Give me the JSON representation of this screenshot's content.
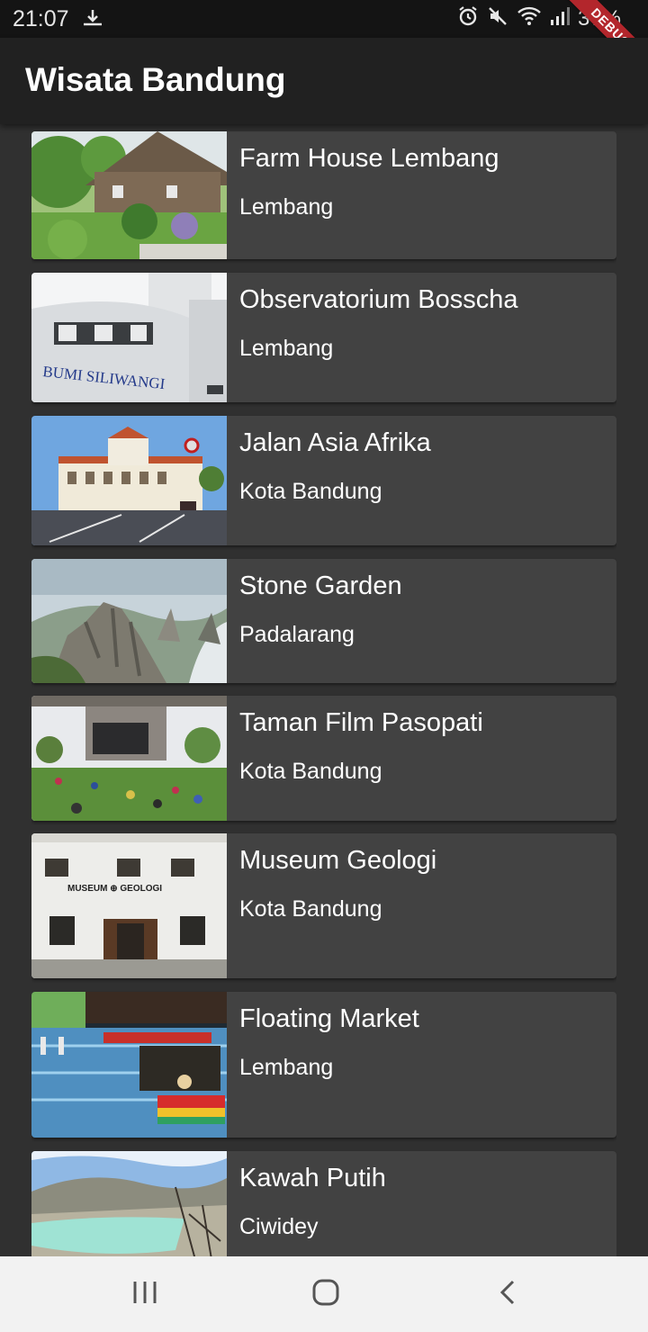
{
  "status_bar": {
    "time": "21:07",
    "battery": "37%",
    "icons": [
      "download-icon",
      "alarm-icon",
      "mute-icon",
      "wifi-icon",
      "signal-icon"
    ]
  },
  "debug_banner": "DEBUG",
  "app_bar": {
    "title": "Wisata Bandung"
  },
  "places": [
    {
      "name": "Farm House Lembang",
      "location": "Lembang"
    },
    {
      "name": "Observatorium Bosscha",
      "location": "Lembang"
    },
    {
      "name": "Jalan Asia Afrika",
      "location": "Kota Bandung"
    },
    {
      "name": "Stone Garden",
      "location": "Padalarang"
    },
    {
      "name": "Taman Film Pasopati",
      "location": "Kota Bandung"
    },
    {
      "name": "Museum Geologi",
      "location": "Kota Bandung"
    },
    {
      "name": "Floating Market",
      "location": "Lembang"
    },
    {
      "name": "Kawah Putih",
      "location": "Ciwidey"
    }
  ],
  "image_text": {
    "observatorium": "BUMI SILIWANGI",
    "museum": "MUSEUM ⊕ GEOLOGI"
  },
  "nav_bar": {
    "icons": [
      "recent-apps-icon",
      "home-icon",
      "back-icon"
    ]
  }
}
